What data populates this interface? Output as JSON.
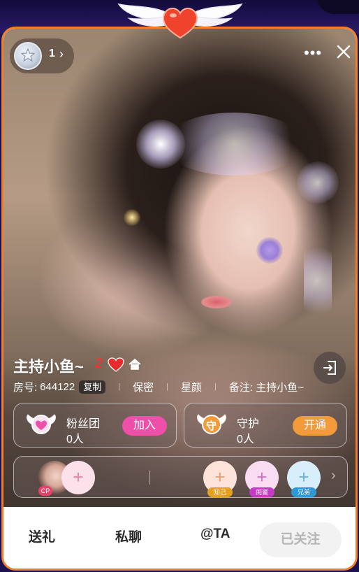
{
  "colors": {
    "card_border": "#ef7f2e",
    "fan_join_button": "#ee4fa8",
    "guard_open_button": "#f39a3a",
    "unfollow_bg": "#f2f2f2",
    "unfollow_text": "#b5b5b5",
    "host_level": "#e23a3a"
  },
  "header": {
    "level_value": "1",
    "level_chevron": "›",
    "more_label": "•••",
    "level_badge_icon": "star-badge-icon",
    "close_icon": "close-icon"
  },
  "profile": {
    "name": "主持小鱼~",
    "level": "2",
    "room_label": "房号:",
    "room_id": "644122",
    "copy_label": "复制",
    "privacy": "保密",
    "constellation": "星颜",
    "remark": "备注: 主持小鱼~"
  },
  "fan_club": {
    "title": "粉丝团",
    "count": "0人",
    "action": "加入",
    "icon": "winged-heart-icon"
  },
  "guard": {
    "title": "守护",
    "count": "0人",
    "action": "开通",
    "icon": "winged-guard-icon",
    "emblem_text": "守"
  },
  "relations": {
    "cp_tag": "CP",
    "plus": "+",
    "slots": [
      {
        "tag": "知己",
        "tag_color": "#e6a020"
      },
      {
        "tag": "闺蜜",
        "tag_color": "#c43bc4"
      },
      {
        "tag": "兄弟",
        "tag_color": "#2b9ad6"
      }
    ],
    "more_chevron": "›"
  },
  "actions": {
    "gift": "送礼",
    "private_chat": "私聊",
    "at": "@TA",
    "follow_state": "已关注"
  }
}
